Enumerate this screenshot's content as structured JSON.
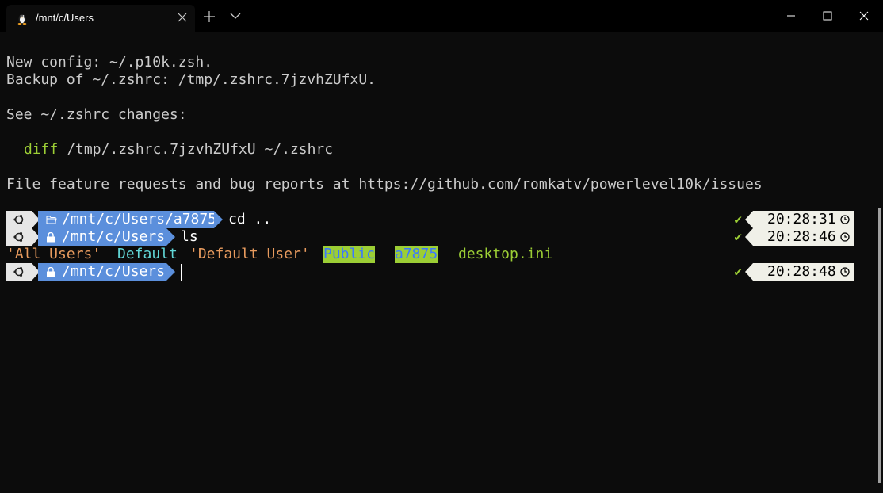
{
  "tab": {
    "title": "/mnt/c/Users"
  },
  "output": {
    "line1": "New config: ~/.p10k.zsh.",
    "line2": "Backup of ~/.zshrc: /tmp/.zshrc.7jzvhZUfxU.",
    "line3": "See ~/.zshrc changes:",
    "diff_cmd": "diff",
    "diff_args": " /tmp/.zshrc.7jzvhZUfxU ~/.zshrc",
    "line5": "File feature requests and bug reports at https://github.com/romkatv/powerlevel10k/issues"
  },
  "prompts": [
    {
      "path": "/mnt/c/Users/a7875",
      "icon": "folder-icon",
      "command": "cd ..",
      "status": "✔",
      "time": "20:28:31"
    },
    {
      "path": "/mnt/c/Users",
      "icon": "lock-icon",
      "command": "ls",
      "status": "✔",
      "time": "20:28:46"
    },
    {
      "path": "/mnt/c/Users",
      "icon": "lock-icon",
      "command": "",
      "status": "✔",
      "time": "20:28:48"
    }
  ],
  "ls_output": [
    "'All Users'",
    "Default",
    "'Default User'",
    "Public",
    "a7875",
    "desktop.ini"
  ],
  "colors": {
    "path_segment": "#5b8fdc",
    "os_segment": "#e6e6e6",
    "time_segment": "#f0f0e8",
    "green": "#9cce35",
    "cyan": "#61d6d6",
    "orange": "#e89b5e"
  }
}
